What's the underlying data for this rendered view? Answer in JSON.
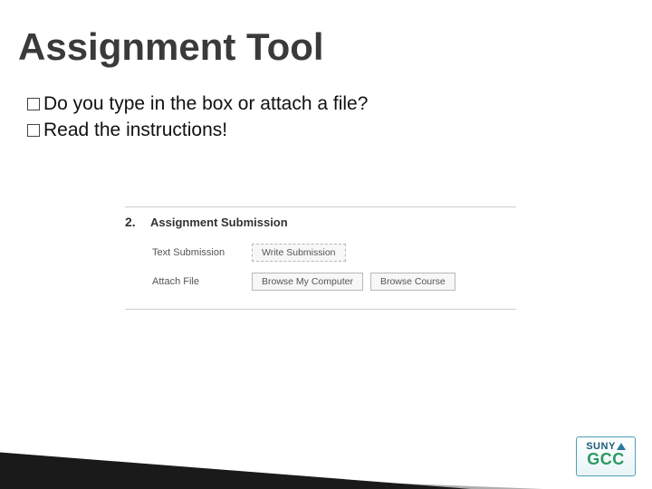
{
  "title": "Assignment Tool",
  "bullets": {
    "b1": "Do you type in the box or attach a file?",
    "b2": "Read the instructions!"
  },
  "screenshot": {
    "step_number": "2.",
    "heading": "Assignment Submission",
    "row_text": {
      "label": "Text Submission",
      "write_btn": "Write Submission"
    },
    "row_file": {
      "label": "Attach File",
      "browse_computer_btn": "Browse My Computer",
      "browse_course_btn": "Browse Course"
    }
  },
  "logo": {
    "line1": "SUNY",
    "line2": "GCC"
  }
}
